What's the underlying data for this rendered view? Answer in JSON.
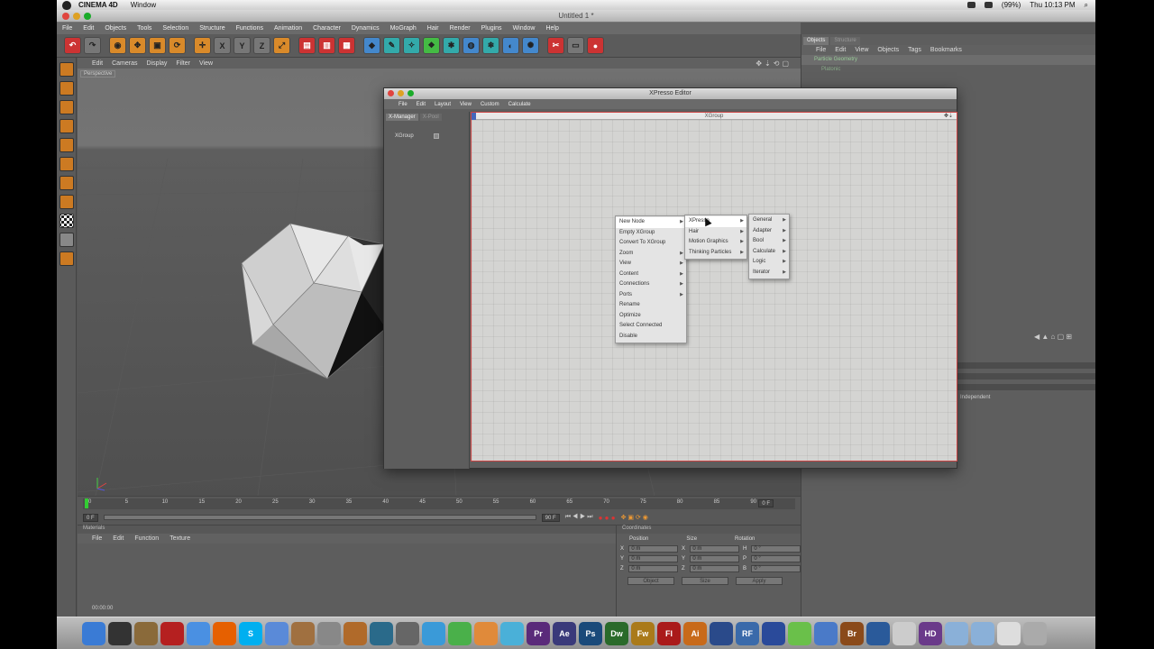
{
  "mac_menubar": {
    "app_name": "CINEMA 4D",
    "window_menu": "Window",
    "clock": "Thu 10:13 PM",
    "battery": "(99%)"
  },
  "window_title": "Untitled 1 *",
  "main_menu": [
    "File",
    "Edit",
    "Objects",
    "Tools",
    "Selection",
    "Structure",
    "Functions",
    "Animation",
    "Character",
    "Dynamics",
    "MoGraph",
    "Hair",
    "Render",
    "Plugins",
    "Window",
    "Help"
  ],
  "viewport": {
    "menu": [
      "Edit",
      "Cameras",
      "Display",
      "Filter",
      "View"
    ],
    "label": "Perspective"
  },
  "timeline": {
    "ticks": [
      "0",
      "5",
      "10",
      "15",
      "20",
      "25",
      "30",
      "35",
      "40",
      "45",
      "50",
      "55",
      "60",
      "65",
      "70",
      "75",
      "80",
      "85",
      "90"
    ],
    "start_field": "0 F",
    "current_field": "0 F",
    "end_field": "90 F",
    "end_frame": "0 F"
  },
  "materials": {
    "header": "Materials",
    "menu": [
      "File",
      "Edit",
      "Function",
      "Texture"
    ],
    "time_readout": "00:00:00"
  },
  "coordinates": {
    "header": "Coordinates",
    "columns": [
      "Position",
      "Size",
      "Rotation"
    ],
    "rows": [
      {
        "axis": "X",
        "pos": "0 m",
        "size_axis": "X",
        "size": "0 m",
        "rot_axis": "H",
        "rot": "0 °"
      },
      {
        "axis": "Y",
        "pos": "0 m",
        "size_axis": "Y",
        "size": "0 m",
        "rot_axis": "P",
        "rot": "0 °"
      },
      {
        "axis": "Z",
        "pos": "0 m",
        "size_axis": "Z",
        "size": "0 m",
        "rot_axis": "B",
        "rot": "0 °"
      }
    ],
    "mode_object": "Object",
    "mode_size": "Size",
    "apply": "Apply"
  },
  "objects_panel": {
    "tabs": [
      "Objects",
      "Structure"
    ],
    "menu": [
      "File",
      "Edit",
      "View",
      "Objects",
      "Tags",
      "Bookmarks"
    ],
    "items": [
      {
        "name": "Particle Geometry"
      },
      {
        "name": "Platonic"
      }
    ],
    "attr_text": "Independent"
  },
  "xpresso": {
    "title": "XPresso Editor",
    "menu": [
      "File",
      "Edit",
      "Layout",
      "View",
      "Custom",
      "Calculate"
    ],
    "tabs": [
      "X-Manager",
      "X-Pool"
    ],
    "tree_item": "XGroup",
    "canvas_title": "XGroup"
  },
  "context_menu": {
    "main": [
      {
        "label": "New Node",
        "submenu": true,
        "active": true
      },
      {
        "label": "Empty XGroup",
        "submenu": false
      },
      {
        "label": "Convert To XGroup",
        "submenu": false
      },
      {
        "label": "Zoom",
        "submenu": true
      },
      {
        "label": "View",
        "submenu": true
      },
      {
        "label": "Content",
        "submenu": true
      },
      {
        "label": "Connections",
        "submenu": true
      },
      {
        "label": "Ports",
        "submenu": true
      },
      {
        "label": "Rename",
        "submenu": false
      },
      {
        "label": "Optimize",
        "submenu": false
      },
      {
        "label": "Select Connected",
        "submenu": false
      },
      {
        "label": "Disable",
        "submenu": false
      }
    ],
    "sub1": [
      {
        "label": "XPresso",
        "submenu": true,
        "active": true
      },
      {
        "label": "Hair",
        "submenu": true
      },
      {
        "label": "Motion Graphics",
        "submenu": true
      },
      {
        "label": "Thinking Particles",
        "submenu": true
      }
    ],
    "sub2": [
      {
        "label": "General",
        "submenu": true
      },
      {
        "label": "Adapter",
        "submenu": true
      },
      {
        "label": "Bool",
        "submenu": true
      },
      {
        "label": "Calculate",
        "submenu": true
      },
      {
        "label": "Logic",
        "submenu": true
      },
      {
        "label": "Iterator",
        "submenu": true
      }
    ]
  },
  "dock_icons": [
    {
      "name": "finder-icon",
      "color": "#3a7bd5",
      "glyph": ""
    },
    {
      "name": "dashboard-icon",
      "color": "#333333",
      "glyph": ""
    },
    {
      "name": "preview-icon",
      "color": "#8a6a3a",
      "glyph": ""
    },
    {
      "name": "books-icon",
      "color": "#b52020",
      "glyph": ""
    },
    {
      "name": "itunes-icon",
      "color": "#4a90e2",
      "glyph": ""
    },
    {
      "name": "firefox-icon",
      "color": "#e66000",
      "glyph": ""
    },
    {
      "name": "skype-icon",
      "color": "#00aff0",
      "glyph": "S"
    },
    {
      "name": "ichat-icon",
      "color": "#5a8ad8",
      "glyph": ""
    },
    {
      "name": "photos-icon",
      "color": "#a07040",
      "glyph": ""
    },
    {
      "name": "tools-icon",
      "color": "#888888",
      "glyph": ""
    },
    {
      "name": "guitar-icon",
      "color": "#b06a2a",
      "glyph": ""
    },
    {
      "name": "timemachine-icon",
      "color": "#2a6a8a",
      "glyph": ""
    },
    {
      "name": "screenshot-icon",
      "color": "#666666",
      "glyph": ""
    },
    {
      "name": "flash-icon",
      "color": "#3a9ad8",
      "glyph": ""
    },
    {
      "name": "bird-icon",
      "color": "#4ab04a",
      "glyph": ""
    },
    {
      "name": "hammer-icon",
      "color": "#e08a3a",
      "glyph": ""
    },
    {
      "name": "grid-icon",
      "color": "#4ab0d8",
      "glyph": ""
    },
    {
      "name": "premiere-icon",
      "color": "#5a2a7a",
      "glyph": "Pr"
    },
    {
      "name": "aftereffects-icon",
      "color": "#3a3a7a",
      "glyph": "Ae"
    },
    {
      "name": "photoshop-icon",
      "color": "#1a4a7a",
      "glyph": "Ps"
    },
    {
      "name": "dreamweaver-icon",
      "color": "#2a6a2a",
      "glyph": "Dw"
    },
    {
      "name": "fireworks-icon",
      "color": "#aa7a1a",
      "glyph": "Fw"
    },
    {
      "name": "flash-pro-icon",
      "color": "#aa1a1a",
      "glyph": "Fl"
    },
    {
      "name": "illustrator-icon",
      "color": "#c86a1a",
      "glyph": "Ai"
    },
    {
      "name": "globe-icon",
      "color": "#2a4a8a",
      "glyph": ""
    },
    {
      "name": "rf-icon",
      "color": "#3a6aaa",
      "glyph": "RF"
    },
    {
      "name": "arrow-icon",
      "color": "#2a4a9a",
      "glyph": ""
    },
    {
      "name": "green-ball-icon",
      "color": "#6ac04a",
      "glyph": ""
    },
    {
      "name": "sphere-icon",
      "color": "#4a7ac8",
      "glyph": ""
    },
    {
      "name": "bridge-icon",
      "color": "#8a4a1a",
      "glyph": "Br"
    },
    {
      "name": "qt-icon",
      "color": "#2a5a9a",
      "glyph": ""
    },
    {
      "name": "doc-icon",
      "color": "#cccccc",
      "glyph": ""
    },
    {
      "name": "hd-icon",
      "color": "#6a3a8a",
      "glyph": "HD"
    },
    {
      "name": "folder1-icon",
      "color": "#8ab0d8",
      "glyph": ""
    },
    {
      "name": "folder2-icon",
      "color": "#8ab0d8",
      "glyph": ""
    },
    {
      "name": "file-icon",
      "color": "#dddddd",
      "glyph": ""
    },
    {
      "name": "trash-icon",
      "color": "#aaaaaa",
      "glyph": ""
    }
  ]
}
